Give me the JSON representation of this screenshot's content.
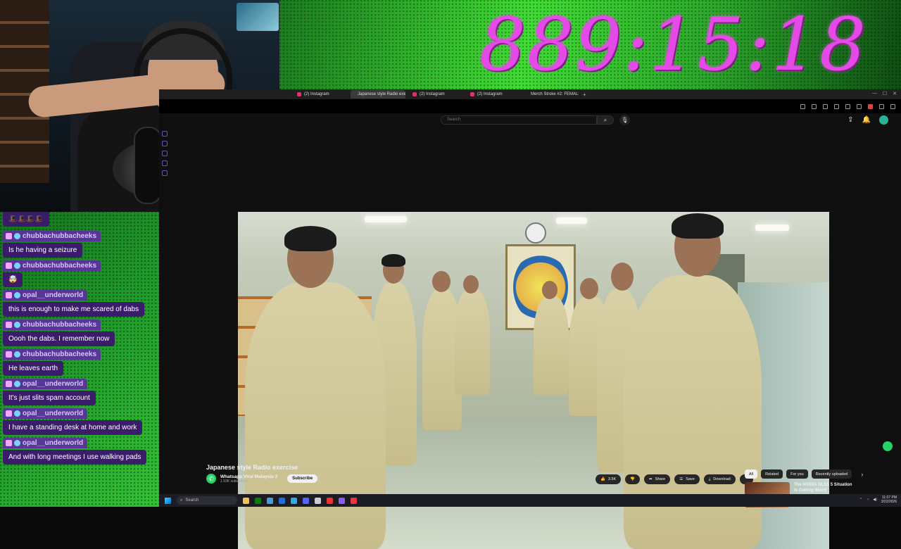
{
  "overlay": {
    "timer": "889:15:18",
    "timer_color": "#e44ae6"
  },
  "chat": {
    "top_message": "🎩🎩🎩🎩",
    "messages": [
      {
        "user": "chubbachubbacheeks",
        "text": "Is he having a seizure"
      },
      {
        "user": "chubbachubbacheeks",
        "text": "🤯"
      },
      {
        "user": "opal__underworld",
        "text": "this is enough to make me scared of dabs"
      },
      {
        "user": "chubbachubbacheeks",
        "text": "Oooh the dabs. I remember now"
      },
      {
        "user": "chubbachubbacheeks",
        "text": "He leaves earth"
      },
      {
        "user": "opal__underworld",
        "text": "It's just slits spam account"
      },
      {
        "user": "opal__underworld",
        "text": "I have a standing desk at home and work"
      },
      {
        "user": "opal__underworld",
        "text": "And with long meetings I use walking pads"
      }
    ]
  },
  "browser": {
    "tabs": [
      {
        "label": "(2) Instagram",
        "icon_color": "#e1306c",
        "active": false
      },
      {
        "label": "Japanese style Radio exe",
        "icon_color": "#ff0000",
        "active": true
      },
      {
        "label": "(2) Instagram",
        "icon_color": "#e1306c",
        "active": false
      },
      {
        "label": "(2) Instagram",
        "icon_color": "#e1306c",
        "active": false
      },
      {
        "label": "Merch Stroke #2: FEMALE",
        "icon_color": "#ff0000",
        "active": false
      }
    ],
    "new_tab": "+"
  },
  "youtube": {
    "search_placeholder": "Search",
    "video_title": "Japanese style Radio exercise",
    "channel": {
      "name": "Whatsapp Viral Malaysia 3",
      "subscribers": "1.93K subscribers",
      "subscribe_label": "Subscribe"
    },
    "actions": {
      "likes": "3.5K",
      "share": "Share",
      "save": "Save",
      "download": "Download",
      "more": "⋯"
    },
    "filters": [
      "All",
      "Related",
      "For you",
      "Recently uploaded"
    ],
    "recommended": {
      "title": "The NVIDIA DLSS 5 Situation Is Getting Weird"
    }
  },
  "taskbar": {
    "search_label": "Search",
    "time": "11:07 PM",
    "date": "3/22/2026"
  }
}
